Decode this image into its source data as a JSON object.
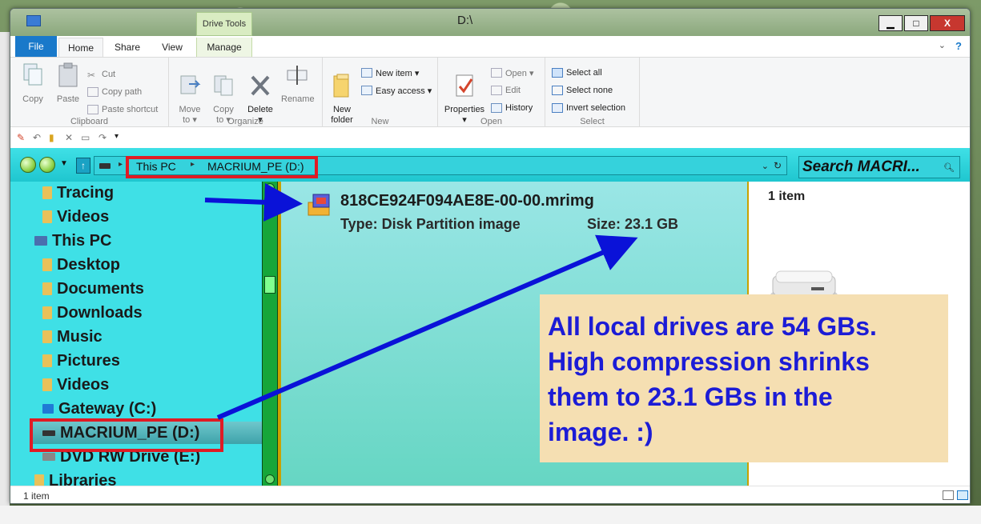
{
  "window": {
    "title": "D:\\"
  },
  "title_buttons": {
    "minimize": "▁",
    "maximize": "□",
    "close": "X"
  },
  "tabs": {
    "file": "File",
    "home": "Home",
    "share": "Share",
    "view": "View",
    "context_group": "Drive Tools",
    "manage": "Manage"
  },
  "ribbon": {
    "clipboard": {
      "label": "Clipboard",
      "copy": "Copy",
      "paste": "Paste",
      "cut": "Cut",
      "copy_path": "Copy path",
      "paste_shortcut": "Paste shortcut"
    },
    "organize": {
      "label": "Organize",
      "move_to": "Move\nto ▾",
      "copy_to": "Copy\nto ▾",
      "delete": "Delete\n▾",
      "rename": "Rename"
    },
    "new": {
      "label": "New",
      "new_folder": "New\nfolder",
      "new_item": "New item ▾",
      "easy_access": "Easy access ▾"
    },
    "open": {
      "label": "Open",
      "properties": "Properties\n▾",
      "open": "Open ▾",
      "edit": "Edit",
      "history": "History"
    },
    "select": {
      "label": "Select",
      "select_all": "Select all",
      "select_none": "Select none",
      "invert": "Invert selection"
    }
  },
  "address": {
    "crumbs": [
      "This PC",
      "MACRIUM_PE (D:)"
    ],
    "search_placeholder": "Search MACRI..."
  },
  "nav_pane": {
    "items": [
      {
        "label": "Tracing",
        "icon": "folder-icon"
      },
      {
        "label": "Videos",
        "icon": "folder-icon"
      },
      {
        "label": "This PC",
        "icon": "computer-icon"
      },
      {
        "label": "Desktop",
        "icon": "folder-icon"
      },
      {
        "label": "Documents",
        "icon": "folder-icon"
      },
      {
        "label": "Downloads",
        "icon": "folder-icon"
      },
      {
        "label": "Music",
        "icon": "folder-icon"
      },
      {
        "label": "Pictures",
        "icon": "folder-icon"
      },
      {
        "label": "Videos",
        "icon": "folder-icon"
      },
      {
        "label": "Gateway (C:)",
        "icon": "windows-drive-icon"
      },
      {
        "label": "MACRIUM_PE (D:)",
        "icon": "drive-icon",
        "selected": true
      },
      {
        "label": "DVD RW Drive (E:)",
        "icon": "dvd-drive-icon"
      },
      {
        "label": "Libraries",
        "icon": "library-icon"
      }
    ]
  },
  "file": {
    "name": "818CE924F094AE8E-00-00.mrimg",
    "type": "Type: Disk Partition image",
    "size": "Size: 23.1 GB"
  },
  "details": {
    "count": "1 item"
  },
  "annotation": {
    "lines": [
      "All local drives are 54 GBs.",
      "High compression shrinks",
      "them to 23.1 GBs in the",
      "image. :)"
    ]
  },
  "status": {
    "count": "1 item"
  },
  "colors": {
    "nav_bg": "#3fe0e6",
    "content_bg": "#7fe0d2",
    "annotation_text": "#1c1cd6",
    "annotation_bg": "#f5dfb2",
    "highlight_box": "#e01b24",
    "arrow": "#0a12d8"
  }
}
